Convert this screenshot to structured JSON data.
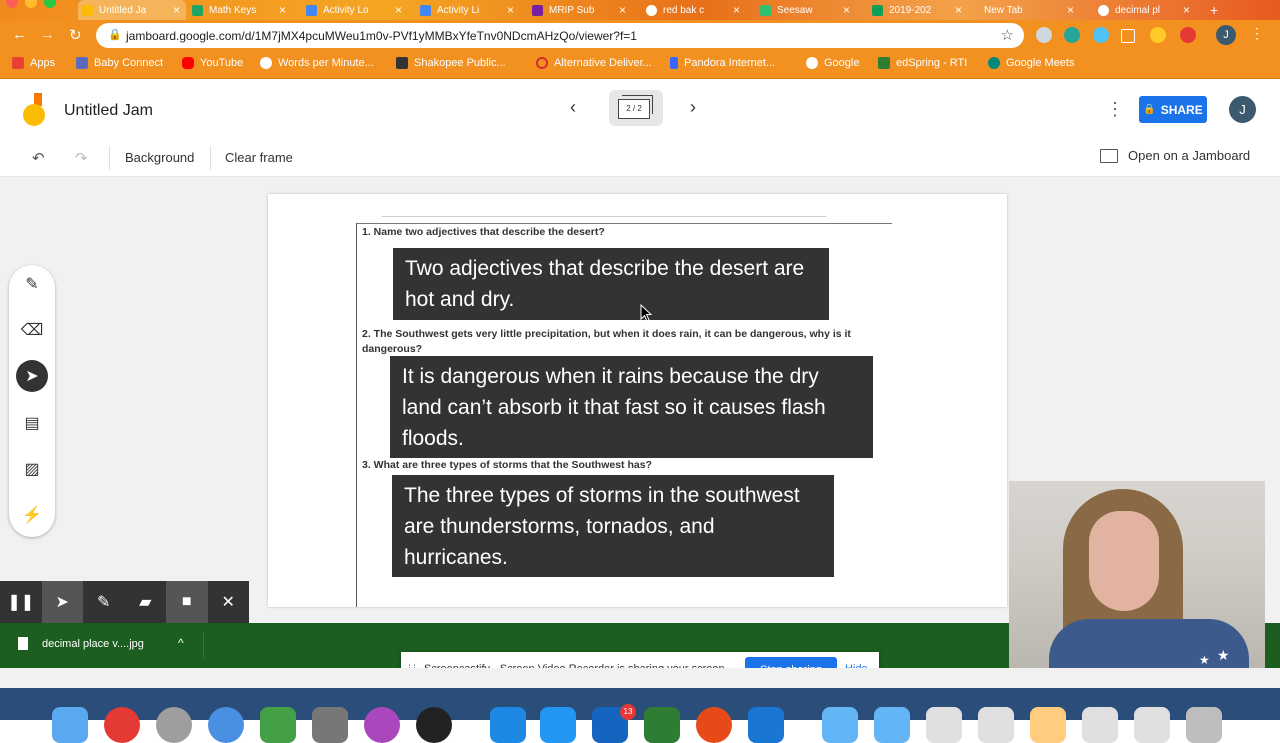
{
  "browser": {
    "tabs": [
      {
        "label": "Untitled Ja",
        "active": true,
        "icon": "jamboard-icon",
        "color": "#fbbc04"
      },
      {
        "label": "Math Keys",
        "icon": "drive-icon",
        "color": "#1fa463"
      },
      {
        "label": "Activity Lo",
        "icon": "docs-icon",
        "color": "#4285f4"
      },
      {
        "label": "Activity Li",
        "icon": "docs-icon",
        "color": "#4285f4"
      },
      {
        "label": "MRIP Sub",
        "icon": "forms-icon",
        "color": "#7b1fa2"
      },
      {
        "label": "red bak c",
        "icon": "google-icon",
        "color": "#ffffff"
      },
      {
        "label": "Seesaw",
        "icon": "seesaw-icon",
        "color": "#2fbf71"
      },
      {
        "label": "2019-202",
        "icon": "sheets-icon",
        "color": "#0f9d58"
      },
      {
        "label": "New Tab",
        "icon": "",
        "color": ""
      },
      {
        "label": "decimal pl",
        "icon": "google-icon",
        "color": "#ffffff"
      }
    ],
    "new_tab": "+",
    "url": "jamboard.google.com/d/1M7jMX4pcuMWeu1m0v-PVf1yMMBxYfeTnv0NDcmAHzQo/viewer?f=1",
    "profile_initial": "J",
    "bookmarks": [
      {
        "label": "Apps",
        "icon": "apps-grid-icon",
        "color": "#e94235"
      },
      {
        "label": "Baby Connect",
        "icon": "baby-connect-icon",
        "color": "#5c6bc0"
      },
      {
        "label": "YouTube",
        "icon": "youtube-icon",
        "color": "#ff0000"
      },
      {
        "label": "Words per Minute...",
        "icon": "globe-icon",
        "color": "#ffffff"
      },
      {
        "label": "Shakopee Public...",
        "icon": "school-icon",
        "color": "#333333"
      },
      {
        "label": "Alternative Deliver...",
        "icon": "circle-icon",
        "color": "#d32f2f"
      },
      {
        "label": "Pandora Internet...",
        "icon": "pandora-icon",
        "color": "#3668ff"
      },
      {
        "label": "Google",
        "icon": "google-icon",
        "color": "#ffffff"
      },
      {
        "label": "edSpring - RTI",
        "icon": "edspring-icon",
        "color": "#2e7d32"
      },
      {
        "label": "Google Meets",
        "icon": "meet-icon",
        "color": "#00897b"
      }
    ]
  },
  "jamboard": {
    "title": "Untitled Jam",
    "frame_counter": "2 / 2",
    "share_label": "SHARE",
    "avatar_initial": "J",
    "toolbar": {
      "background_label": "Background",
      "clear_frame_label": "Clear frame",
      "open_on_jamboard_label": "Open on a Jamboard"
    },
    "questions": [
      "1. Name two adjectives that describe the desert?",
      "2. The Southwest gets very little precipitation, but when it does rain, it can be dangerous, why is it dangerous?",
      "3. What are three types of storms that the Southwest has?"
    ],
    "answers": [
      "Two adjectives that describe the desert are hot and dry.",
      "It is dangerous when it rains because the dry land can’t absorb it that fast so it causes flash floods.",
      "The three types of storms in the southwest are thunderstorms, tornados, and hurricanes."
    ],
    "tools": [
      "pen-icon",
      "eraser-icon",
      "select-arrow-icon",
      "sticky-note-icon",
      "image-icon",
      "laser-icon"
    ],
    "selected_tool": "select-arrow-icon"
  },
  "screencastify": {
    "tools": [
      "pause-icon",
      "cursor-icon",
      "pen-icon",
      "highlighter-icon",
      "camera-icon",
      "close-icon"
    ],
    "banner_message": "Screencastify - Screen Video Recorder is sharing your screen.",
    "stop_label": "Stop sharing",
    "hide_label": "Hide"
  },
  "download_bar": {
    "filename": "decimal place v....jpg"
  },
  "dock": {
    "badge_count": "13"
  },
  "colors": {
    "browser_chrome": "#f29020",
    "share_blue": "#1a73e8",
    "answer_box": "#333333",
    "download_bar": "#1b5e20"
  }
}
